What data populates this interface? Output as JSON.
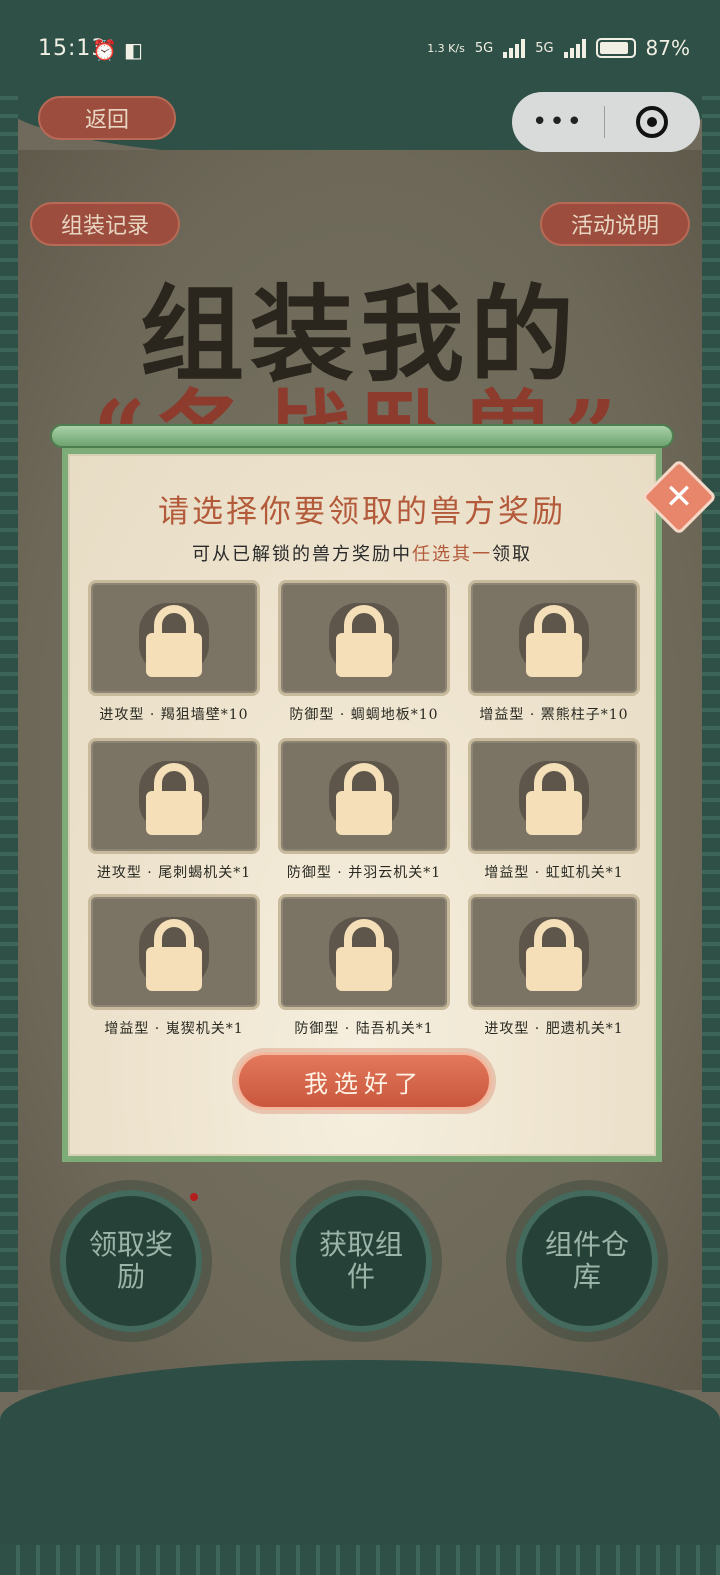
{
  "status_bar": {
    "time": "15:13",
    "net_speed": "1.3 K/s",
    "net1": "5G",
    "net2": "5G",
    "battery": "87%"
  },
  "nav": {
    "back_label": "返回",
    "record_label": "组装记录",
    "rules_label": "活动说明"
  },
  "hero": {
    "title": "组装我的",
    "subtitle": "“各战卧兽”"
  },
  "modal": {
    "title": "请选择你要领取的兽方奖励",
    "sub_prefix": "可从已解锁的兽方奖励中",
    "sub_highlight": "任选其一",
    "sub_suffix": "领取",
    "close_icon": "✕",
    "confirm_label": "我选好了",
    "items": [
      {
        "label": "进攻型 · 羯狙墙壁*10"
      },
      {
        "label": "防御型 · 蜩蜩地板*10"
      },
      {
        "label": "增益型 · 罴熊柱子*10"
      },
      {
        "label": "进攻型 · 尾刺蝎机关*1"
      },
      {
        "label": "防御型 · 并羽云机关*1"
      },
      {
        "label": "增益型 · 虹虹机关*1"
      },
      {
        "label": "增益型 · 嵬猰机关*1"
      },
      {
        "label": "防御型 · 陆吾机关*1"
      },
      {
        "label": "进攻型 · 肥遗机关*1"
      }
    ]
  },
  "bottom": {
    "btn1": "领取奖励",
    "btn2": "获取组件",
    "btn3": "组件仓库"
  },
  "colors": {
    "accent": "#c9573d",
    "frame_green": "#7eac79",
    "dark_green": "#2f5046"
  }
}
